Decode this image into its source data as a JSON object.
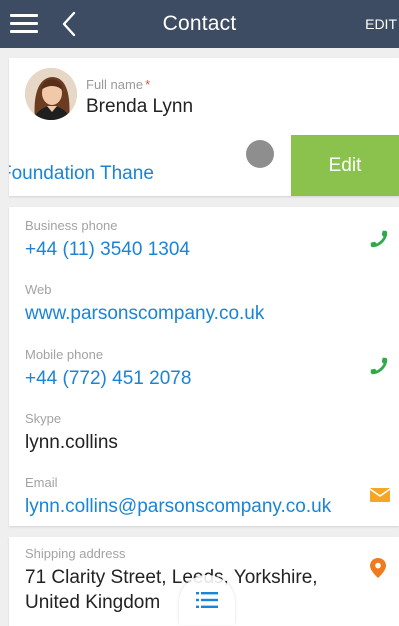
{
  "header": {
    "title": "Contact",
    "edit_label": "EDIT"
  },
  "profile": {
    "full_name_label": "Full name",
    "required_marker": "*",
    "full_name": "Brenda Lynn",
    "account": "Foundation Thane",
    "swipe_action": "Edit"
  },
  "communication": {
    "business_phone": {
      "label": "Business phone",
      "value": "+44 (11) 3540 1304",
      "icon": "phone-icon"
    },
    "web": {
      "label": "Web",
      "value": "www.parsonscompany.co.uk"
    },
    "mobile_phone": {
      "label": "Mobile phone",
      "value": "+44 (772) 451 2078",
      "icon": "phone-icon"
    },
    "skype": {
      "label": "Skype",
      "value": "lynn.collins"
    },
    "email": {
      "label": "Email",
      "value": "lynn.collins@parsonscompany.co.uk",
      "icon": "envelope-icon"
    }
  },
  "address": {
    "label": "Shipping address",
    "line1": "71 Clarity Street, Leeds, Yorkshire,",
    "line2": "United Kingdom",
    "icon": "map-pin-icon"
  },
  "colors": {
    "header_bg": "#3d4c63",
    "link": "#1a84d7",
    "phone_green": "#2eaa4a",
    "email_orange": "#f5a623",
    "pin_orange": "#f07b1e",
    "swipe_green": "#8bc24e"
  }
}
